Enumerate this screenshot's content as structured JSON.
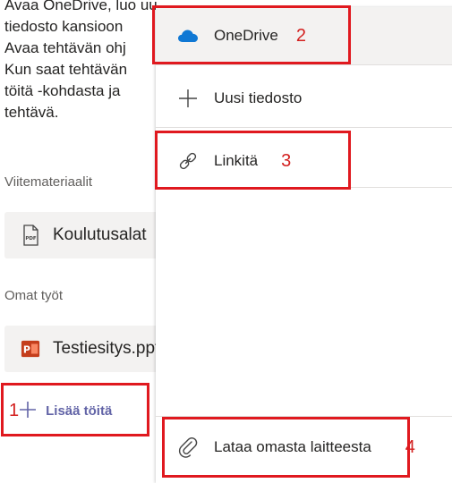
{
  "instructions": {
    "lines": [
      "Avaa OneDrive, luo uusi PowerPoint-",
      "tiedosto kansioon",
      "Avaa tehtävän ohj",
      "Kun saat tehtävän",
      "töitä -kohdasta ja",
      "tehtävä."
    ]
  },
  "reference": {
    "label": "Viitemateriaalit",
    "file": {
      "name": "Koulutusalat",
      "icon": "pdf-file-icon"
    }
  },
  "my_work": {
    "label": "Omat työt",
    "file": {
      "name": "Testiesitys.pptx",
      "icon": "powerpoint-icon",
      "brand_color": "#c43e1c"
    },
    "add_button": {
      "label": "Lisää töitä",
      "number": "1",
      "icon": "plus-icon",
      "color": "#6264a7"
    }
  },
  "menu": {
    "items": [
      {
        "label": "OneDrive",
        "icon": "onedrive-cloud-icon",
        "number": "2",
        "icon_color": "#0f78d4"
      },
      {
        "label": "Uusi tiedosto",
        "icon": "plus-icon"
      },
      {
        "label": "Linkitä",
        "icon": "link-icon",
        "number": "3"
      },
      {
        "label": "Lataa omasta laitteesta",
        "icon": "attachment-icon",
        "number": "4"
      }
    ]
  },
  "colors": {
    "highlight": "#e0191f",
    "accent": "#6264a7",
    "selected_row": "#f3f2f1"
  }
}
